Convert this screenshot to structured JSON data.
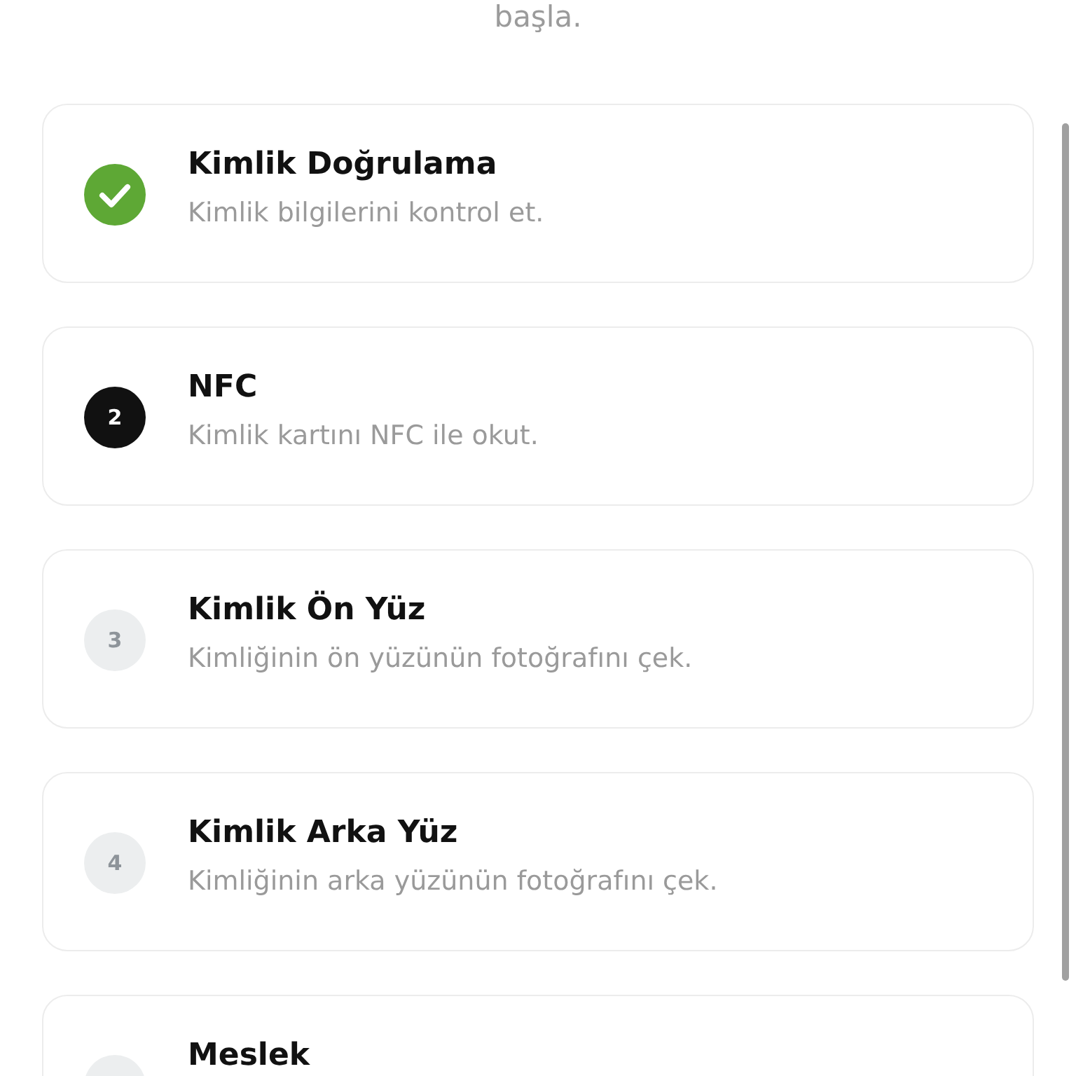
{
  "intro_text": "başla.",
  "steps": [
    {
      "completed": true,
      "title": "Kimlik Doğrulama",
      "description": "Kimlik bilgilerini kontrol et."
    },
    {
      "completed": false,
      "selected": true,
      "number": "2",
      "title": "NFC",
      "description": "Kimlik kartını NFC ile okut."
    },
    {
      "completed": false,
      "selected": false,
      "number": "3",
      "title": "Kimlik Ön Yüz",
      "description": "Kimliğinin ön yüzünün fotoğrafını çek."
    },
    {
      "completed": false,
      "selected": false,
      "number": "4",
      "title": "Kimlik Arka Yüz",
      "description": "Kimliğinin arka yüzünün fotoğrafını çek."
    },
    {
      "completed": false,
      "selected": false,
      "title": "Meslek"
    }
  ]
}
